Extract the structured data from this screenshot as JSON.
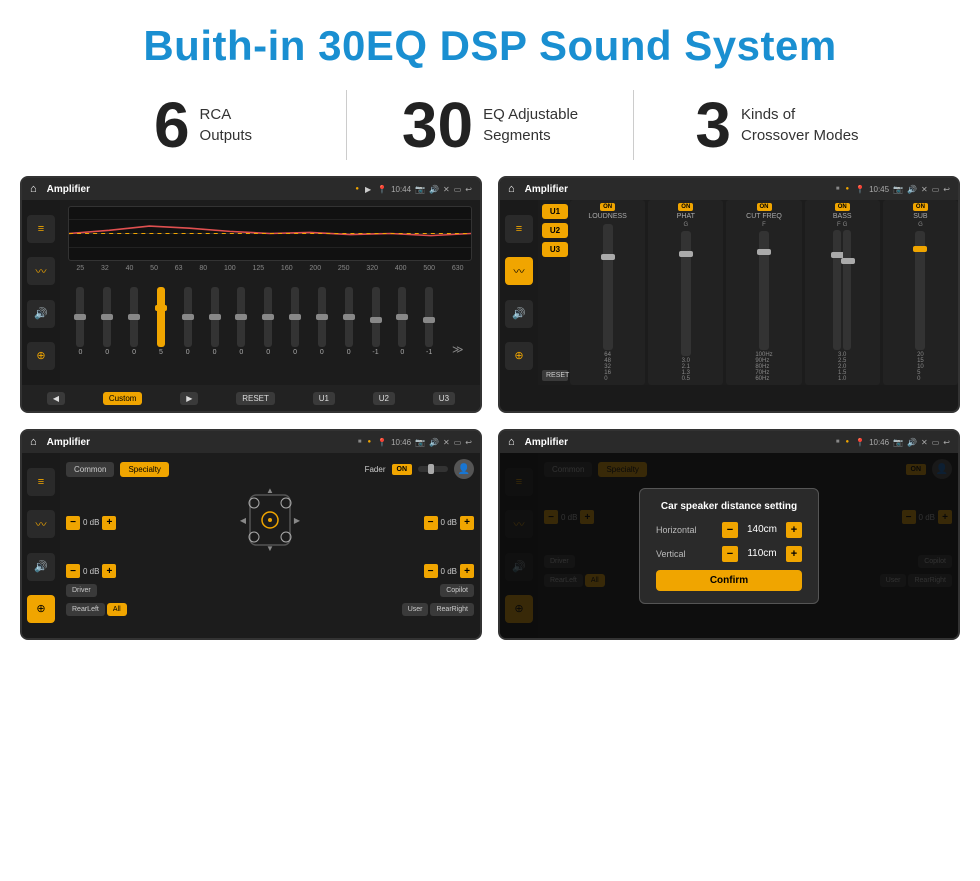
{
  "page": {
    "title": "Buith-in 30EQ DSP Sound System"
  },
  "stats": [
    {
      "number": "6",
      "label": "RCA\nOutputs"
    },
    {
      "number": "30",
      "label": "EQ Adjustable\nSegments"
    },
    {
      "number": "3",
      "label": "Kinds of\nCrossover Modes"
    }
  ],
  "screen1": {
    "status_bar": {
      "app": "Amplifier",
      "time": "10:44"
    },
    "eq_labels": [
      "25",
      "32",
      "40",
      "50",
      "63",
      "80",
      "100",
      "125",
      "160",
      "200",
      "250",
      "320",
      "400",
      "500",
      "630"
    ],
    "eq_values": [
      "0",
      "0",
      "0",
      "5",
      "0",
      "0",
      "0",
      "0",
      "0",
      "0",
      "0",
      "-1",
      "0",
      "-1"
    ],
    "bottom_btns": [
      "Custom",
      "RESET",
      "U1",
      "U2",
      "U3"
    ]
  },
  "screen2": {
    "status_bar": {
      "app": "Amplifier",
      "time": "10:45"
    },
    "presets": [
      "U1",
      "U2",
      "U3"
    ],
    "channels": [
      {
        "label": "LOUDNESS",
        "on": true
      },
      {
        "label": "PHAT",
        "on": true
      },
      {
        "label": "CUT FREQ",
        "on": true
      },
      {
        "label": "BASS",
        "on": true
      },
      {
        "label": "SUB",
        "on": true
      }
    ],
    "reset_label": "RESET"
  },
  "screen3": {
    "status_bar": {
      "app": "Amplifier",
      "time": "10:46"
    },
    "tabs": [
      "Common",
      "Specialty"
    ],
    "fader_label": "Fader",
    "on_label": "ON",
    "db_values": [
      "0 dB",
      "0 dB",
      "0 dB",
      "0 dB"
    ],
    "bottom_btns": [
      "Driver",
      "",
      "Copilot",
      "RearLeft",
      "All",
      "",
      "User",
      "RearRight"
    ]
  },
  "screen4": {
    "status_bar": {
      "app": "Amplifier",
      "time": "10:46"
    },
    "tabs": [
      "Common",
      "Specialty"
    ],
    "on_label": "ON",
    "dialog": {
      "title": "Car speaker distance setting",
      "horizontal_label": "Horizontal",
      "horizontal_value": "140cm",
      "vertical_label": "Vertical",
      "vertical_value": "110cm",
      "confirm_label": "Confirm"
    },
    "db_values": [
      "0 dB",
      "0 dB"
    ],
    "bottom_btns": [
      "Driver",
      "Copilot",
      "RearLeft",
      "All",
      "User",
      "RearRight"
    ]
  }
}
